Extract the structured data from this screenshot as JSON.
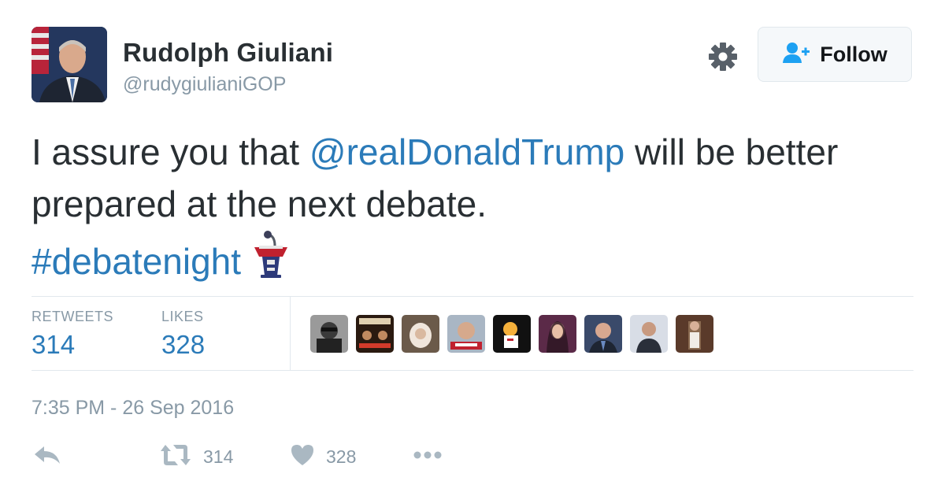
{
  "author": {
    "name": "Rudolph Giuliani",
    "handle": "@rudygiulianiGOP"
  },
  "follow_label": "Follow",
  "tweet": {
    "text_1": "I assure you that ",
    "mention": "@realDonaldTrump",
    "text_2": " will be better prepared at the next debate.",
    "hashtag": "#debatenight"
  },
  "stats": {
    "retweets_label": "RETWEETS",
    "retweets_value": "314",
    "likes_label": "LIKES",
    "likes_value": "328"
  },
  "timestamp": "7:35 PM - 26 Sep 2016",
  "actions": {
    "retweet_count": "314",
    "like_count": "328"
  },
  "icons": {
    "settings": "gear-icon",
    "follow": "person-add-icon",
    "reply": "reply-arrow-icon",
    "retweet": "retweet-icon",
    "like": "heart-icon",
    "more": "ellipsis-icon",
    "emoji": "podium-emoji"
  },
  "colors": {
    "link": "#2b7bb9",
    "muted": "#8899a6",
    "text": "#292f33",
    "border": "#e1e8ed"
  }
}
